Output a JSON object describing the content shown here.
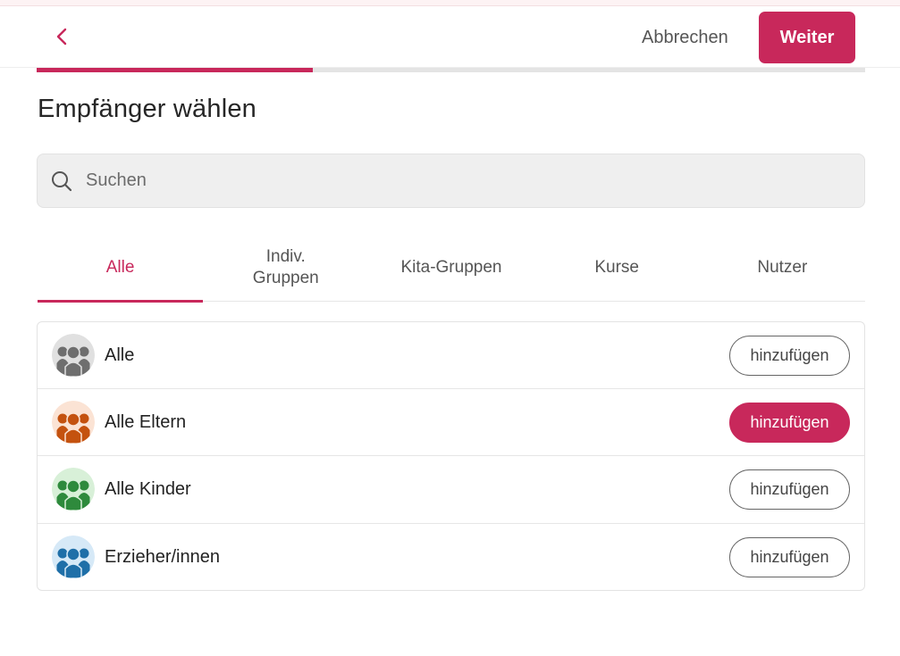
{
  "header": {
    "cancel_label": "Abbrechen",
    "next_label": "Weiter"
  },
  "progress": {
    "fraction": 0.333,
    "color": "#c8285b"
  },
  "page": {
    "title": "Empfänger wählen"
  },
  "search": {
    "placeholder": "Suchen",
    "value": ""
  },
  "tabs": [
    {
      "label": "Alle",
      "active": true
    },
    {
      "label": "Indiv.\nGruppen",
      "active": false
    },
    {
      "label": "Kita-Gruppen",
      "active": false
    },
    {
      "label": "Kurse",
      "active": false
    },
    {
      "label": "Nutzer",
      "active": false
    }
  ],
  "recipients": [
    {
      "label": "Alle",
      "icon": "group-gray-icon",
      "avatar_bg": "#e0e0e0",
      "avatar_fg": "#6e6e6e",
      "button_label": "hinzufügen",
      "selected": false
    },
    {
      "label": "Alle Eltern",
      "icon": "parents-group-icon",
      "avatar_bg": "#fbe3d4",
      "avatar_fg": "#c4520f",
      "button_label": "hinzufügen",
      "selected": true
    },
    {
      "label": "Alle Kinder",
      "icon": "children-group-icon",
      "avatar_bg": "#d8f0d8",
      "avatar_fg": "#2e8a3c",
      "button_label": "hinzufügen",
      "selected": false
    },
    {
      "label": "Erzieher/innen",
      "icon": "educators-group-icon",
      "avatar_bg": "#d6e9f7",
      "avatar_fg": "#1f6fa8",
      "button_label": "hinzufügen",
      "selected": false
    }
  ],
  "colors": {
    "accent": "#c8285b"
  }
}
